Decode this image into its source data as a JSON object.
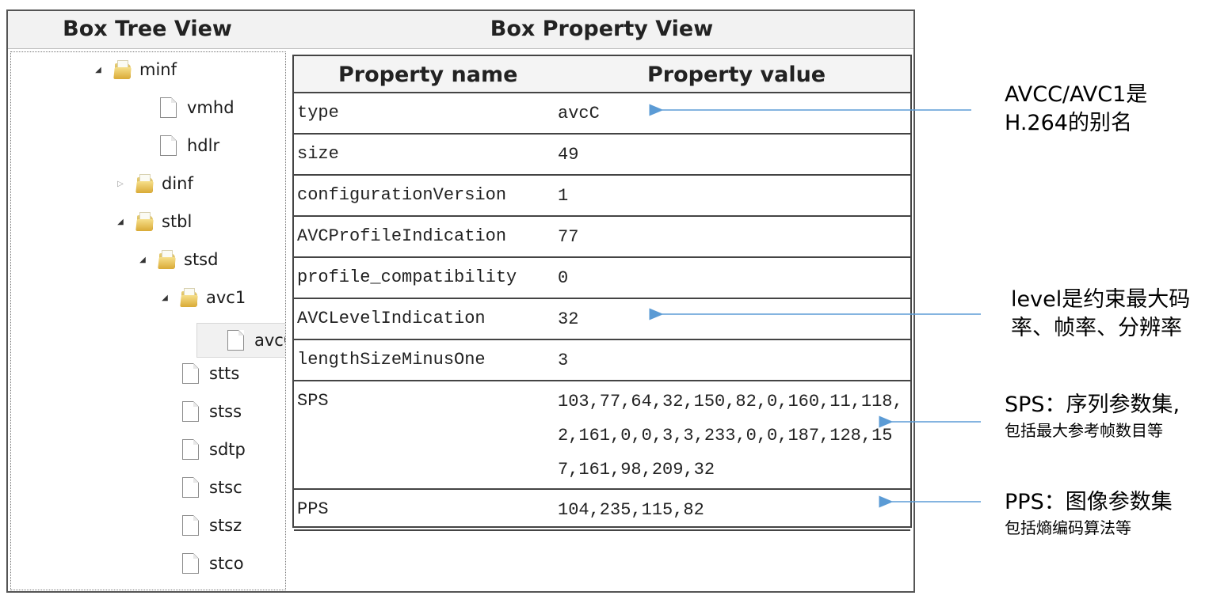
{
  "panes": {
    "tree_title": "Box Tree View",
    "property_title": "Box Property View"
  },
  "tree": {
    "nodes": [
      {
        "label": "minf",
        "kind": "folder",
        "toggle": "expanded",
        "depth": 0
      },
      {
        "label": "vmhd",
        "kind": "file",
        "toggle": "none",
        "depth": 1
      },
      {
        "label": "hdlr",
        "kind": "file",
        "toggle": "none",
        "depth": 1
      },
      {
        "label": "dinf",
        "kind": "folder",
        "toggle": "collapsed",
        "depth": 1
      },
      {
        "label": "stbl",
        "kind": "folder",
        "toggle": "expanded",
        "depth": 1
      },
      {
        "label": "stsd",
        "kind": "folder",
        "toggle": "expanded",
        "depth": 2
      },
      {
        "label": "avc1",
        "kind": "folder",
        "toggle": "expanded",
        "depth": 3
      },
      {
        "label": "avcC",
        "kind": "file",
        "toggle": "none",
        "depth": 4,
        "selected": true
      },
      {
        "label": "stts",
        "kind": "file",
        "toggle": "none",
        "depth": 2
      },
      {
        "label": "stss",
        "kind": "file",
        "toggle": "none",
        "depth": 2
      },
      {
        "label": "sdtp",
        "kind": "file",
        "toggle": "none",
        "depth": 2
      },
      {
        "label": "stsc",
        "kind": "file",
        "toggle": "none",
        "depth": 2
      },
      {
        "label": "stsz",
        "kind": "file",
        "toggle": "none",
        "depth": 2
      },
      {
        "label": "stco",
        "kind": "file",
        "toggle": "none",
        "depth": 2
      }
    ]
  },
  "table": {
    "headers": {
      "name": "Property name",
      "value": "Property value"
    },
    "rows": [
      {
        "name": "type",
        "value": "avcC"
      },
      {
        "name": "size",
        "value": "49"
      },
      {
        "name": "configurationVersion",
        "value": "1"
      },
      {
        "name": "AVCProfileIndication",
        "value": "77"
      },
      {
        "name": "profile_compatibility",
        "value": "0"
      },
      {
        "name": "AVCLevelIndication",
        "value": "32"
      },
      {
        "name": "lengthSizeMinusOne",
        "value": "3"
      },
      {
        "name": "SPS",
        "value": "103,77,64,32,150,82,0,160,11,118,2,161,0,0,3,3,233,0,0,187,128,157,161,98,209,32"
      },
      {
        "name": "PPS",
        "value": "104,235,115,82"
      }
    ]
  },
  "annotations": [
    {
      "lines": [
        "AVCC/AVC1是",
        "H.264的别名"
      ],
      "sub": ""
    },
    {
      "lines": [
        "level是约束最大码",
        "率、帧率、分辨率"
      ],
      "sub": ""
    },
    {
      "lines": [
        "SPS：序列参数集,"
      ],
      "sub": "包括最大参考帧数目等"
    },
    {
      "lines": [
        "PPS：图像参数集"
      ],
      "sub": "包括熵编码算法等"
    }
  ],
  "colors": {
    "arrow": "#5b9bd5",
    "folder": "#e2b84a",
    "border": "#444444",
    "header_bg": "#f2f2f2"
  },
  "icons": {
    "folder": "folder-icon",
    "file": "file-icon",
    "expanded": "triangle-expanded-icon",
    "collapsed": "triangle-collapsed-icon"
  }
}
